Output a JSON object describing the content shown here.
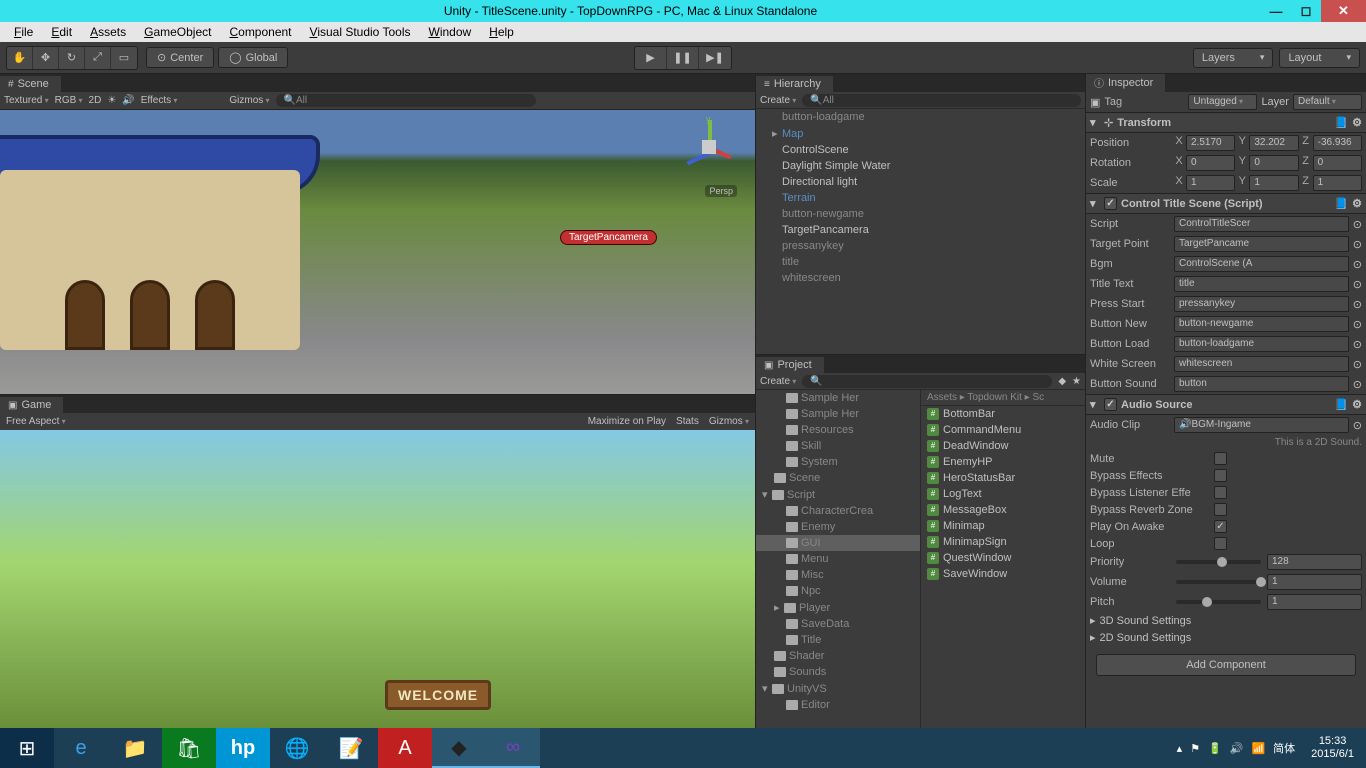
{
  "window": {
    "title": "Unity - TitleScene.unity - TopDownRPG - PC, Mac & Linux Standalone"
  },
  "menu": [
    "File",
    "Edit",
    "Assets",
    "GameObject",
    "Component",
    "Visual Studio Tools",
    "Window",
    "Help"
  ],
  "toolbar": {
    "center": "Center",
    "global": "Global",
    "layers": "Layers",
    "layout": "Layout"
  },
  "scene": {
    "tab": "Scene",
    "shading": "Textured",
    "rgb": "RGB",
    "mode2d": "2D",
    "effects": "Effects",
    "gizmos": "Gizmos",
    "search_ph": "All",
    "targetLabel": "TargetPancamera",
    "persp": "Persp"
  },
  "game": {
    "tab": "Game",
    "aspect": "Free Aspect",
    "max": "Maximize on Play",
    "stats": "Stats",
    "gizmos": "Gizmos",
    "welcome": "WELCOME"
  },
  "hierarchy": {
    "tab": "Hierarchy",
    "create": "Create",
    "search_ph": "All",
    "items": [
      {
        "label": "button-loadgame",
        "cls": ""
      },
      {
        "label": "Map",
        "cls": "link",
        "arrow": "▸"
      },
      {
        "label": "ControlScene",
        "cls": "active"
      },
      {
        "label": "Daylight Simple Water",
        "cls": "active"
      },
      {
        "label": "Directional light",
        "cls": "active"
      },
      {
        "label": "Terrain",
        "cls": "link"
      },
      {
        "label": "button-newgame",
        "cls": ""
      },
      {
        "label": "TargetPancamera",
        "cls": "active"
      },
      {
        "label": "pressanykey",
        "cls": ""
      },
      {
        "label": "title",
        "cls": ""
      },
      {
        "label": "whitescreen",
        "cls": ""
      }
    ]
  },
  "project": {
    "tab": "Project",
    "create": "Create",
    "tree": [
      {
        "label": "Sample Her",
        "d": ""
      },
      {
        "label": "Sample Her",
        "d": ""
      },
      {
        "label": "Resources",
        "d": ""
      },
      {
        "label": "Skill",
        "d": ""
      },
      {
        "label": "System",
        "d": ""
      },
      {
        "label": "Scene",
        "d": "d1"
      },
      {
        "label": "Script",
        "d": "d1",
        "arrow": "▾"
      },
      {
        "label": "CharacterCrea",
        "d": ""
      },
      {
        "label": "Enemy",
        "d": ""
      },
      {
        "label": "GUI",
        "d": "",
        "sel": true
      },
      {
        "label": "Menu",
        "d": ""
      },
      {
        "label": "Misc",
        "d": ""
      },
      {
        "label": "Npc",
        "d": ""
      },
      {
        "label": "Player",
        "d": "",
        "arrow": "▸"
      },
      {
        "label": "SaveData",
        "d": ""
      },
      {
        "label": "Title",
        "d": ""
      },
      {
        "label": "Shader",
        "d": "d1"
      },
      {
        "label": "Sounds",
        "d": "d1"
      },
      {
        "label": "UnityVS",
        "d": "d1",
        "arrow": "▾"
      },
      {
        "label": "Editor",
        "d": ""
      }
    ],
    "breadcrumb": "Assets ▸ Topdown Kit ▸ Sc",
    "files": [
      "BottomBar",
      "CommandMenu",
      "DeadWindow",
      "EnemyHP",
      "HeroStatusBar",
      "LogText",
      "MessageBox",
      "Minimap",
      "MinimapSign",
      "QuestWindow",
      "SaveWindow"
    ]
  },
  "inspector": {
    "tab": "Inspector",
    "tag_l": "Tag",
    "tag": "Untagged",
    "layer_l": "Layer",
    "layer": "Default",
    "transform": {
      "title": "Transform",
      "pos_l": "Position",
      "pos": {
        "x": "2.5170",
        "y": "32.202",
        "z": "-36.936"
      },
      "rot_l": "Rotation",
      "rot": {
        "x": "0",
        "y": "0",
        "z": "0"
      },
      "scl_l": "Scale",
      "scl": {
        "x": "1",
        "y": "1",
        "z": "1"
      }
    },
    "ctlscript": {
      "title": "Control Title Scene (Script)",
      "rows": [
        {
          "l": "Script",
          "v": "ControlTitleScer"
        },
        {
          "l": "Target Point",
          "v": "TargetPancame"
        },
        {
          "l": "Bgm",
          "v": "ControlScene (A"
        },
        {
          "l": "Title Text",
          "v": "title"
        },
        {
          "l": "Press Start",
          "v": "pressanykey"
        },
        {
          "l": "Button New",
          "v": "button-newgame"
        },
        {
          "l": "Button Load",
          "v": "button-loadgame"
        },
        {
          "l": "White Screen",
          "v": "whitescreen"
        },
        {
          "l": "Button Sound",
          "v": "button"
        }
      ]
    },
    "audio": {
      "title": "Audio Source",
      "clip_l": "Audio Clip",
      "clip": "BGM-Ingame",
      "note": "This is a 2D Sound.",
      "checks": [
        {
          "l": "Mute",
          "on": false
        },
        {
          "l": "Bypass Effects",
          "on": false
        },
        {
          "l": "Bypass Listener Effe",
          "on": false
        },
        {
          "l": "Bypass Reverb Zone",
          "on": false
        },
        {
          "l": "Play On Awake",
          "on": true
        },
        {
          "l": "Loop",
          "on": false
        }
      ],
      "priority_l": "Priority",
      "priority": "128",
      "volume_l": "Volume",
      "volume": "1",
      "pitch_l": "Pitch",
      "pitch": "1",
      "s3d": "3D Sound Settings",
      "s2d": "2D Sound Settings"
    },
    "add": "Add Component"
  },
  "taskbar": {
    "time": "15:33",
    "date": "2015/6/1",
    "lang": "简体"
  }
}
